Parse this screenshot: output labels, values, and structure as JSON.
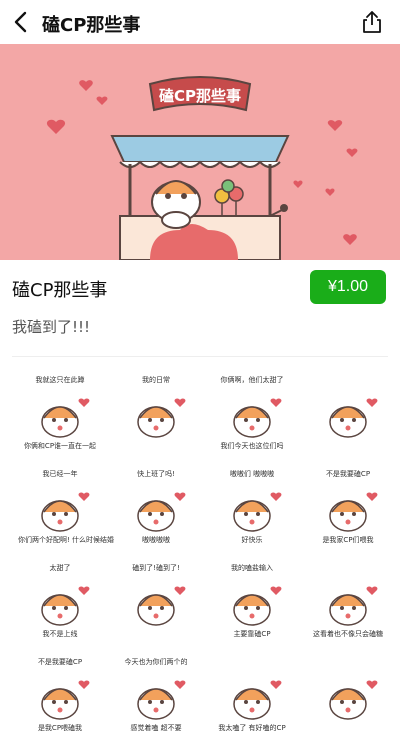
{
  "header": {
    "title": "磕CP那些事",
    "back_icon": "chevron-left-icon",
    "share_icon": "share-icon"
  },
  "banner": {
    "sign_text": "磕CP那些事",
    "bg_color": "#f3a7a6"
  },
  "pack": {
    "title": "磕CP那些事",
    "price": "¥1.00",
    "description": "我磕到了!!!",
    "price_color": "#1aad19"
  },
  "stickers": [
    {
      "text1": "我就这只在此蹲",
      "text2": "你俩和CP谁一直在一起"
    },
    {
      "text1": "我的日常",
      "text2": ""
    },
    {
      "text1": "你俩啊，他们太甜了",
      "text2": "我们今天也这位们吗"
    },
    {
      "text1": "",
      "text2": ""
    },
    {
      "text1": "我已经一年",
      "text2": "你们两个好配啊! 什么时候结婚"
    },
    {
      "text1": "快上班了吗!",
      "text2": "嗷嗷嗷嗷"
    },
    {
      "text1": "嗷嗷们 嗷嗷嗷",
      "text2": "好快乐"
    },
    {
      "text1": "不是我要磕CP",
      "text2": "是我家CP们喂我"
    },
    {
      "text1": "太甜了",
      "text2": "我不是上线"
    },
    {
      "text1": "磕到了!磕到了!",
      "text2": ""
    },
    {
      "text1": "我的嗑盐输入",
      "text2": "主要靠磕CP"
    },
    {
      "text1": "",
      "text2": "这看着也不像只会磕糖"
    },
    {
      "text1": "不是我要磕CP",
      "text2": "是我CP喂磕我"
    },
    {
      "text1": "今天也为你们两个的",
      "text2": "感觉着嗑 超不要"
    },
    {
      "text1": "",
      "text2": "我太嗑了 有好嗑的CP"
    },
    {
      "text1": "",
      "text2": ""
    }
  ]
}
